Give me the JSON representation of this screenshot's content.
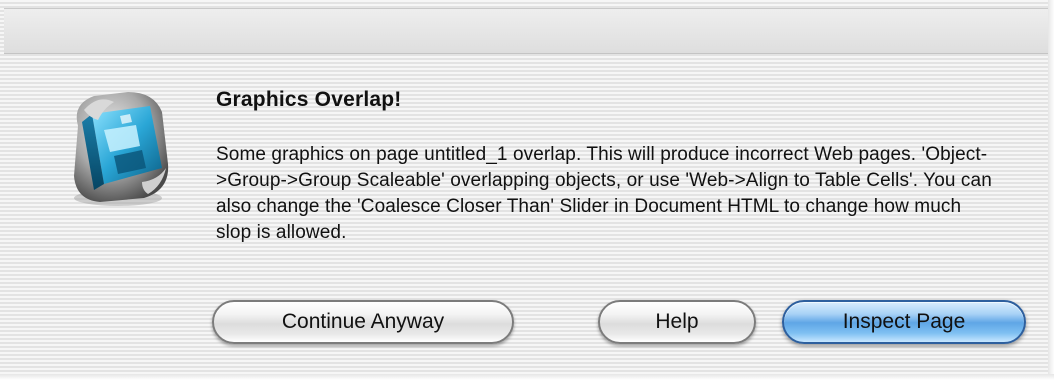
{
  "dialog": {
    "icon": "graphics-app-icon",
    "title": "Graphics Overlap!",
    "message": "Some graphics on page untitled_1 overlap. This will produce incorrect Web pages. 'Object->Group->Group Scaleable' overlapping objects, or use 'Web->Align to Table Cells'. You can also change the 'Coalesce Closer Than' Slider in Document HTML to change how much slop is allowed.",
    "buttons": {
      "continue_label": "Continue Anyway",
      "help_label": "Help",
      "inspect_label": "Inspect Page"
    }
  },
  "colors": {
    "default_button": "#5fa6e6",
    "background_stripe_light": "#f6f6f6",
    "background_stripe_dark": "#e3e3e3"
  }
}
